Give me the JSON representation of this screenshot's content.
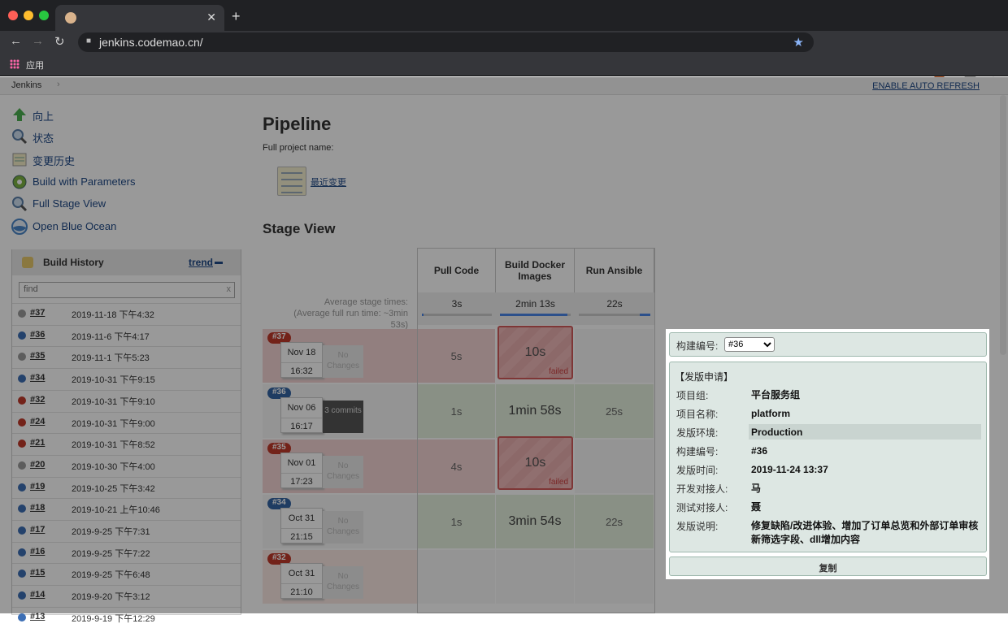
{
  "browser": {
    "url": "jenkins.codemao.cn/",
    "bookmark_label": "应用"
  },
  "crumb": {
    "root": "Jenkins",
    "sep": "›",
    "auto_refresh": "ENABLE AUTO REFRESH"
  },
  "sidebar": {
    "items": [
      {
        "label": "向上",
        "icon": "arrow-up-icon"
      },
      {
        "label": "状态",
        "icon": "search-icon"
      },
      {
        "label": "变更历史",
        "icon": "notepad-icon"
      },
      {
        "label": "Build with Parameters",
        "icon": "build-params-icon"
      },
      {
        "label": "Full Stage View",
        "icon": "search-icon"
      },
      {
        "label": "Open Blue Ocean",
        "icon": "blue-ocean-icon"
      }
    ]
  },
  "build_history": {
    "title": "Build History",
    "trend": "trend",
    "find_placeholder": "find",
    "find_clear": "x",
    "builds": [
      {
        "num": "#37",
        "date": "2019-11-18 下午4:32",
        "status": "grey"
      },
      {
        "num": "#36",
        "date": "2019-11-6 下午4:17",
        "status": "blue"
      },
      {
        "num": "#35",
        "date": "2019-11-1 下午5:23",
        "status": "grey"
      },
      {
        "num": "#34",
        "date": "2019-10-31 下午9:15",
        "status": "blue"
      },
      {
        "num": "#32",
        "date": "2019-10-31 下午9:10",
        "status": "red"
      },
      {
        "num": "#24",
        "date": "2019-10-31 下午9:00",
        "status": "red"
      },
      {
        "num": "#21",
        "date": "2019-10-31 下午8:52",
        "status": "red"
      },
      {
        "num": "#20",
        "date": "2019-10-30 下午4:00",
        "status": "grey"
      },
      {
        "num": "#19",
        "date": "2019-10-25 下午3:42",
        "status": "blue"
      },
      {
        "num": "#18",
        "date": "2019-10-21 上午10:46",
        "status": "blue"
      },
      {
        "num": "#17",
        "date": "2019-9-25 下午7:31",
        "status": "blue"
      },
      {
        "num": "#16",
        "date": "2019-9-25 下午7:22",
        "status": "blue"
      },
      {
        "num": "#15",
        "date": "2019-9-25 下午6:48",
        "status": "blue"
      },
      {
        "num": "#14",
        "date": "2019-9-20 下午3:12",
        "status": "blue"
      },
      {
        "num": "#13",
        "date": "2019-9-19 下午12:29",
        "status": "blue"
      }
    ]
  },
  "main": {
    "title": "Pipeline",
    "full_project_name": "Full project name:",
    "recent_changes": "最近变更",
    "stage_view": "Stage View",
    "avg_line1": "Average stage times:",
    "avg_line2": "(Average full run time: ~3min",
    "avg_line3": "53s)"
  },
  "stages": [
    {
      "name": "Pull Code",
      "avg": "3s",
      "fill": 0.02
    },
    {
      "name": "Build Docker Images",
      "avg": "2min 13s",
      "fill": 0.95
    },
    {
      "name": "Run Ansible",
      "avg": "22s",
      "fill": 0.15
    }
  ],
  "runs": [
    {
      "tag": "#37",
      "color": "#c0392b",
      "date": "Nov 18",
      "time": "16:32",
      "changes": "No Changes",
      "bg": "#f3d4d4",
      "cells": [
        {
          "t": "5s",
          "s": "pink"
        },
        {
          "t": "10s",
          "s": "failed",
          "fl": "failed"
        },
        {
          "t": "",
          "s": "empty"
        }
      ]
    },
    {
      "tag": "#36",
      "color": "#3465a4",
      "date": "Nov 06",
      "time": "16:17",
      "changes": "3 commits",
      "bg": "#f7f7f7",
      "cells": [
        {
          "t": "1s",
          "s": "green"
        },
        {
          "t": "1min 58s",
          "s": "green"
        },
        {
          "t": "25s",
          "s": "green"
        }
      ]
    },
    {
      "tag": "#35",
      "color": "#c0392b",
      "date": "Nov 01",
      "time": "17:23",
      "changes": "No Changes",
      "bg": "#f3d4d4",
      "cells": [
        {
          "t": "4s",
          "s": "pink"
        },
        {
          "t": "10s",
          "s": "failed",
          "fl": "failed"
        },
        {
          "t": "",
          "s": "empty"
        }
      ]
    },
    {
      "tag": "#34",
      "color": "#3465a4",
      "date": "Oct 31",
      "time": "21:15",
      "changes": "No Changes",
      "bg": "#f7f7f7",
      "cells": [
        {
          "t": "1s",
          "s": "green"
        },
        {
          "t": "3min 54s",
          "s": "green"
        },
        {
          "t": "22s",
          "s": "green"
        }
      ]
    },
    {
      "tag": "#32",
      "color": "#c0392b",
      "date": "Oct 31",
      "time": "21:10",
      "changes": "No Changes",
      "bg": "#fae8e3",
      "cells": [
        {
          "t": "",
          "s": "empty"
        },
        {
          "t": "",
          "s": "empty"
        },
        {
          "t": "",
          "s": "empty"
        }
      ]
    }
  ],
  "popup": {
    "build_label": "构建编号:",
    "build_selected": "#36",
    "header": "【发版申请】",
    "fields": [
      {
        "k": "项目组:",
        "v": "平台服务组"
      },
      {
        "k": "项目名称:",
        "v": "platform"
      },
      {
        "k": "发版环境:",
        "v": "Production"
      },
      {
        "k": "构建编号:",
        "v": "#36"
      },
      {
        "k": "发版时间:",
        "v": "2019-11-24 13:37"
      },
      {
        "k": "开发对接人:",
        "v": "马"
      },
      {
        "k": "测试对接人:",
        "v": "聂"
      },
      {
        "k": "发版说明:",
        "v": "修复缺陷/改进体验、增加了订单总览和外部订单审核新筛选字段、dll增加内容"
      }
    ],
    "copy": "复制"
  },
  "colors": {
    "accent": "#204a87",
    "failed": "#d25a5a",
    "success_cell": "#e4f0de",
    "fail_cell": "#f3d4d4"
  }
}
